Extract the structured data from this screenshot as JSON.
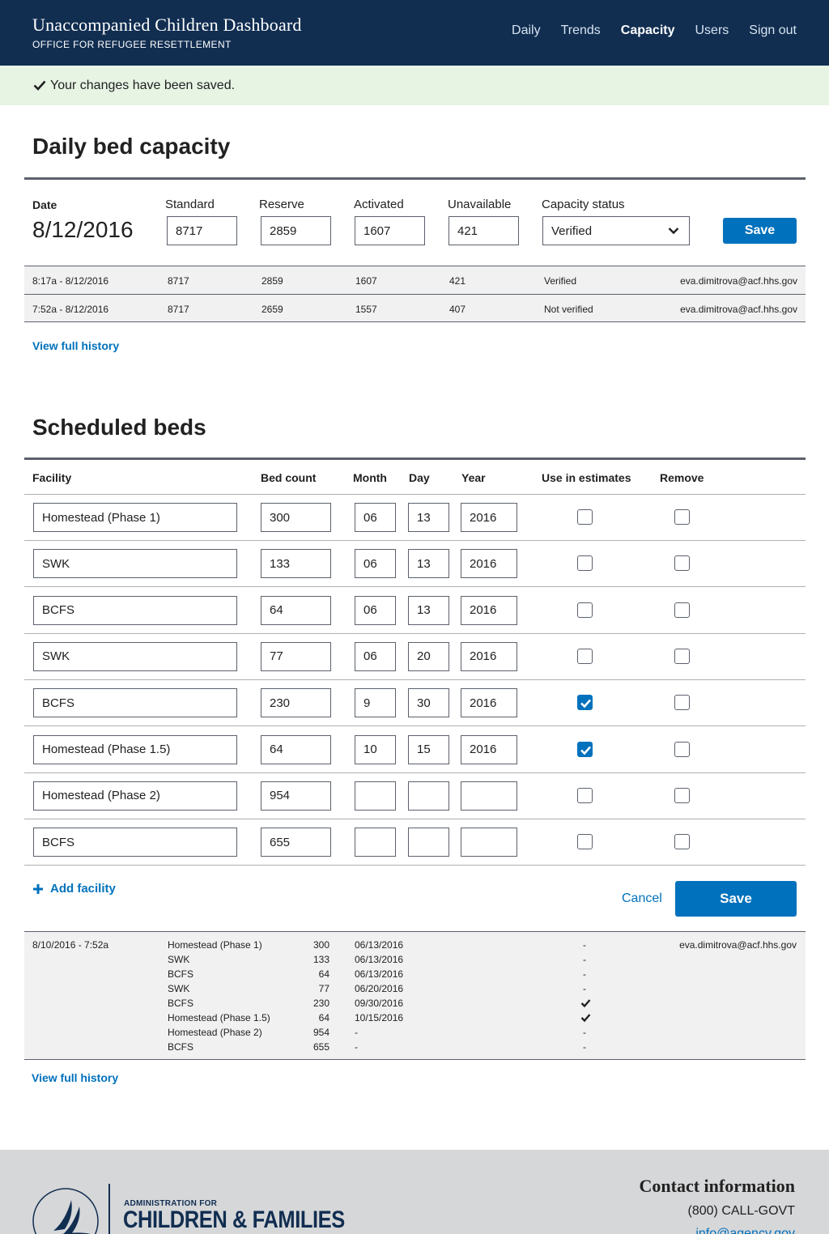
{
  "header": {
    "title": "Unaccompanied Children Dashboard",
    "subtitle": "OFFICE FOR REFUGEE RESETTLEMENT",
    "nav": [
      "Daily",
      "Trends",
      "Capacity",
      "Users",
      "Sign out"
    ],
    "active_nav": "Capacity"
  },
  "alert": {
    "text": "Your changes have been saved.",
    "icon": "check-icon"
  },
  "daily": {
    "heading": "Daily bed capacity",
    "labels": {
      "date": "Date",
      "standard": "Standard",
      "reserve": "Reserve",
      "activated": "Activated",
      "unavailable": "Unavailable",
      "status": "Capacity status"
    },
    "date": "8/12/2016",
    "values": {
      "standard": "8717",
      "reserve": "2859",
      "activated": "1607",
      "unavailable": "421"
    },
    "status": "Verified",
    "save": "Save",
    "history": [
      {
        "time": "8:17a - 8/12/2016",
        "standard": "8717",
        "reserve": "2859",
        "activated": "1607",
        "unavailable": "421",
        "status": "Verified",
        "user": "eva.dimitrova@acf.hhs.gov"
      },
      {
        "time": "7:52a - 8/12/2016",
        "standard": "8717",
        "reserve": "2659",
        "activated": "1557",
        "unavailable": "407",
        "status": "Not verified",
        "user": "eva.dimitrova@acf.hhs.gov"
      }
    ],
    "view_history": "View full history"
  },
  "scheduled": {
    "heading": "Scheduled beds",
    "columns": {
      "facility": "Facility",
      "bed_count": "Bed count",
      "month": "Month",
      "day": "Day",
      "year": "Year",
      "estimates": "Use in estimates",
      "remove": "Remove"
    },
    "rows": [
      {
        "facility": "Homestead (Phase 1)",
        "beds": "300",
        "month": "06",
        "day": "13",
        "year": "2016",
        "estimate": false,
        "remove": false
      },
      {
        "facility": "SWK",
        "beds": "133",
        "month": "06",
        "day": "13",
        "year": "2016",
        "estimate": false,
        "remove": false
      },
      {
        "facility": "BCFS",
        "beds": "64",
        "month": "06",
        "day": "13",
        "year": "2016",
        "estimate": false,
        "remove": false
      },
      {
        "facility": "SWK",
        "beds": "77",
        "month": "06",
        "day": "20",
        "year": "2016",
        "estimate": false,
        "remove": false
      },
      {
        "facility": "BCFS",
        "beds": "230",
        "month": "9",
        "day": "30",
        "year": "2016",
        "estimate": true,
        "remove": false
      },
      {
        "facility": "Homestead (Phase 1.5)",
        "beds": "64",
        "month": "10",
        "day": "15",
        "year": "2016",
        "estimate": true,
        "remove": false
      },
      {
        "facility": "Homestead (Phase 2)",
        "beds": "954",
        "month": "",
        "day": "",
        "year": "",
        "estimate": false,
        "remove": false
      },
      {
        "facility": "BCFS",
        "beds": "655",
        "month": "",
        "day": "",
        "year": "",
        "estimate": false,
        "remove": false
      }
    ],
    "add_facility": "Add facility",
    "cancel": "Cancel",
    "save": "Save",
    "history": {
      "time": "8/10/2016 - 7:52a",
      "user": "eva.dimitrova@acf.hhs.gov",
      "entries": [
        {
          "facility": "Homestead (Phase 1)",
          "beds": "300",
          "date": "06/13/2016",
          "est": "-"
        },
        {
          "facility": "SWK",
          "beds": "133",
          "date": "06/13/2016",
          "est": "-"
        },
        {
          "facility": "BCFS",
          "beds": "64",
          "date": "06/13/2016",
          "est": "-"
        },
        {
          "facility": "SWK",
          "beds": "77",
          "date": "06/20/2016",
          "est": "-"
        },
        {
          "facility": "BCFS",
          "beds": "230",
          "date": "09/30/2016",
          "est": "check"
        },
        {
          "facility": "Homestead (Phase 1.5)",
          "beds": "64",
          "date": "10/15/2016",
          "est": "check"
        },
        {
          "facility": "Homestead (Phase 2)",
          "beds": "954",
          "date": "-",
          "est": "-"
        },
        {
          "facility": "BCFS",
          "beds": "655",
          "date": "-",
          "est": "-"
        }
      ]
    },
    "view_history": "View full history"
  },
  "footer": {
    "logo_small": "ADMINISTRATION FOR",
    "logo_big": "CHILDREN & FAMILIES",
    "contact_title": "Contact information",
    "phone": "(800) CALL-GOVT",
    "email": "info@agency.gov"
  },
  "colors": {
    "navy": "#112e51",
    "blue": "#0071bc",
    "alert_bg": "#e7f4e4",
    "history_bg": "#f1f1f1"
  }
}
